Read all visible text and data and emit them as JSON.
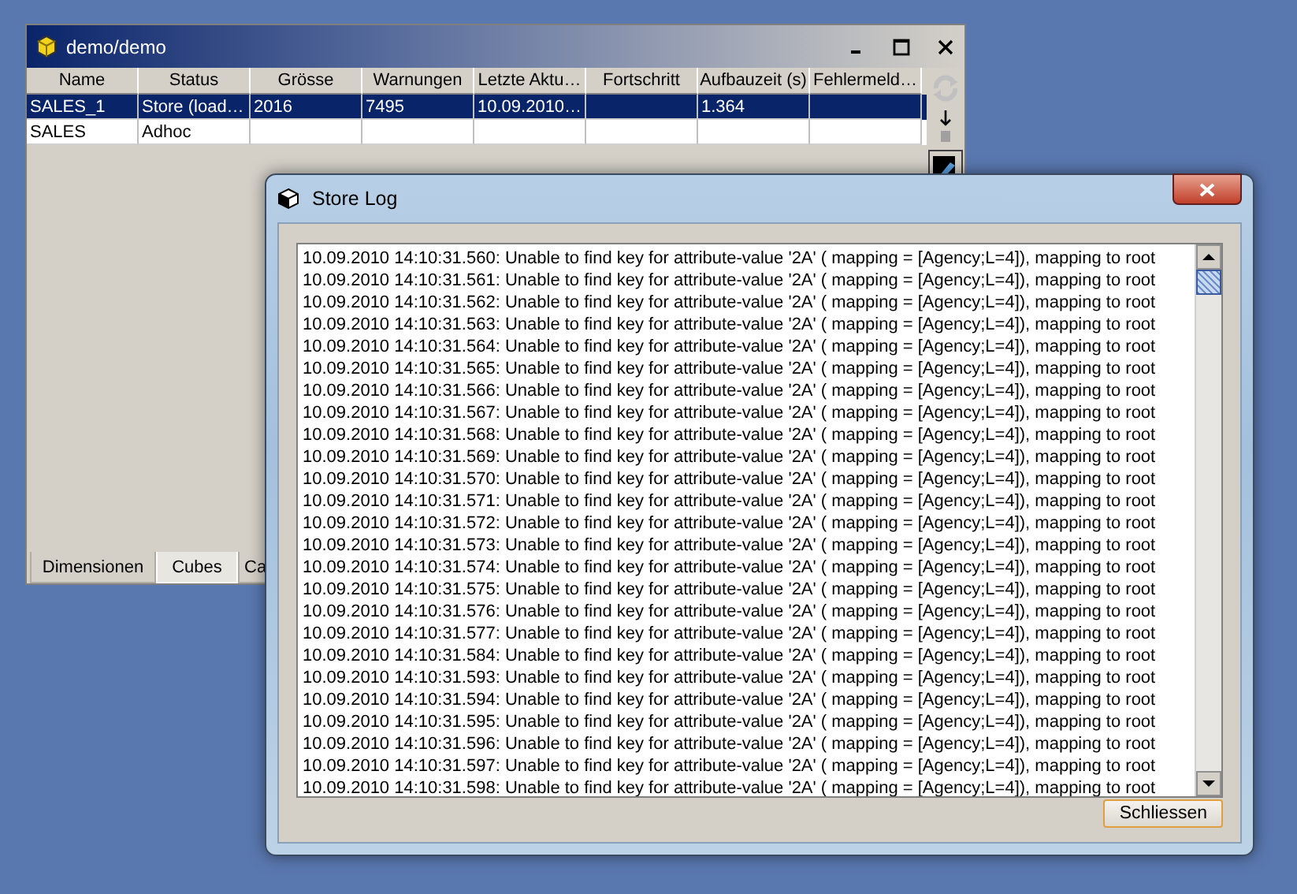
{
  "main_window": {
    "title": "demo/demo",
    "table": {
      "columns": [
        "Name",
        "Status",
        "Grösse",
        "Warnungen",
        "Letzte Aktu…",
        "Fortschritt",
        "Aufbauzeit (s)",
        "Fehlermeld…"
      ],
      "rows": [
        {
          "selected": true,
          "cells": [
            "SALES_1",
            "Store (load…",
            "2016",
            "7495",
            "10.09.2010…",
            "",
            "1.364",
            ""
          ]
        },
        {
          "selected": false,
          "cells": [
            "SALES",
            "Adhoc",
            "",
            "",
            "",
            "",
            "",
            ""
          ]
        }
      ]
    },
    "tabs": [
      {
        "label": "Dimensionen",
        "selected": false
      },
      {
        "label": "Cubes",
        "selected": true
      },
      {
        "label": "Ca",
        "selected": false
      }
    ]
  },
  "dialog": {
    "title": "Store Log",
    "log_lines": [
      "10.09.2010 14:10:31.560: Unable to find key for attribute-value '2A' ( mapping = [Agency;L=4]), mapping to root",
      "10.09.2010 14:10:31.561: Unable to find key for attribute-value '2A' ( mapping = [Agency;L=4]), mapping to root",
      "10.09.2010 14:10:31.562: Unable to find key for attribute-value '2A' ( mapping = [Agency;L=4]), mapping to root",
      "10.09.2010 14:10:31.563: Unable to find key for attribute-value '2A' ( mapping = [Agency;L=4]), mapping to root",
      "10.09.2010 14:10:31.564: Unable to find key for attribute-value '2A' ( mapping = [Agency;L=4]), mapping to root",
      "10.09.2010 14:10:31.565: Unable to find key for attribute-value '2A' ( mapping = [Agency;L=4]), mapping to root",
      "10.09.2010 14:10:31.566: Unable to find key for attribute-value '2A' ( mapping = [Agency;L=4]), mapping to root",
      "10.09.2010 14:10:31.567: Unable to find key for attribute-value '2A' ( mapping = [Agency;L=4]), mapping to root",
      "10.09.2010 14:10:31.568: Unable to find key for attribute-value '2A' ( mapping = [Agency;L=4]), mapping to root",
      "10.09.2010 14:10:31.569: Unable to find key for attribute-value '2A' ( mapping = [Agency;L=4]), mapping to root",
      "10.09.2010 14:10:31.570: Unable to find key for attribute-value '2A' ( mapping = [Agency;L=4]), mapping to root",
      "10.09.2010 14:10:31.571: Unable to find key for attribute-value '2A' ( mapping = [Agency;L=4]), mapping to root",
      "10.09.2010 14:10:31.572: Unable to find key for attribute-value '2A' ( mapping = [Agency;L=4]), mapping to root",
      "10.09.2010 14:10:31.573: Unable to find key for attribute-value '2A' ( mapping = [Agency;L=4]), mapping to root",
      "10.09.2010 14:10:31.574: Unable to find key for attribute-value '2A' ( mapping = [Agency;L=4]), mapping to root",
      "10.09.2010 14:10:31.575: Unable to find key for attribute-value '2A' ( mapping = [Agency;L=4]), mapping to root",
      "10.09.2010 14:10:31.576: Unable to find key for attribute-value '2A' ( mapping = [Agency;L=4]), mapping to root",
      "10.09.2010 14:10:31.577: Unable to find key for attribute-value '2A' ( mapping = [Agency;L=4]), mapping to root",
      "10.09.2010 14:10:31.584: Unable to find key for attribute-value '2A' ( mapping = [Agency;L=4]), mapping to root",
      "10.09.2010 14:10:31.593: Unable to find key for attribute-value '2A' ( mapping = [Agency;L=4]), mapping to root",
      "10.09.2010 14:10:31.594: Unable to find key for attribute-value '2A' ( mapping = [Agency;L=4]), mapping to root",
      "10.09.2010 14:10:31.595: Unable to find key for attribute-value '2A' ( mapping = [Agency;L=4]), mapping to root",
      "10.09.2010 14:10:31.596: Unable to find key for attribute-value '2A' ( mapping = [Agency;L=4]), mapping to root",
      "10.09.2010 14:10:31.597: Unable to find key for attribute-value '2A' ( mapping = [Agency;L=4]), mapping to root",
      "10.09.2010 14:10:31.598: Unable to find key for attribute-value '2A' ( mapping = [Agency;L=4]), mapping to root"
    ],
    "close_button": "Schliessen"
  }
}
